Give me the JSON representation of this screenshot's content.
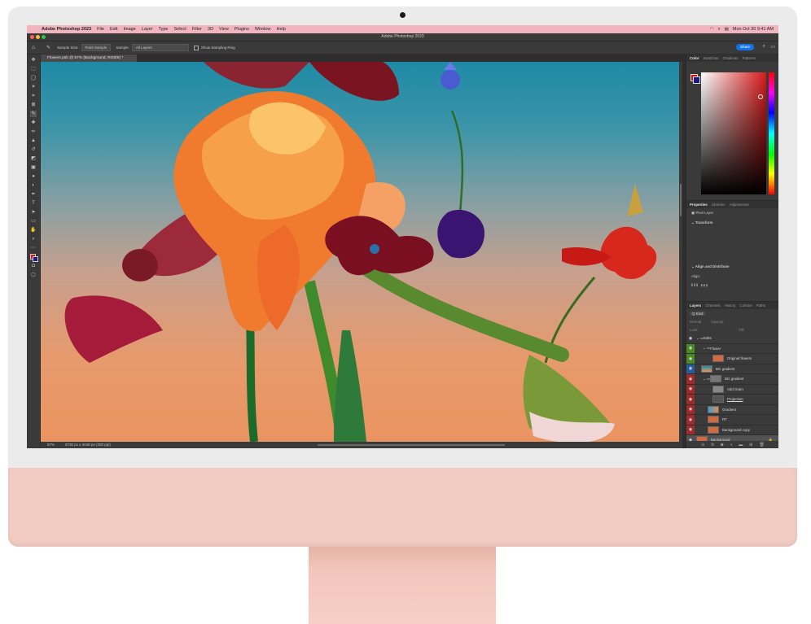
{
  "menubar": {
    "items": [
      "Adobe Photoshop 2023",
      "File",
      "Edit",
      "Image",
      "Layer",
      "Type",
      "Select",
      "Filter",
      "3D",
      "View",
      "Plugins",
      "Window",
      "Help"
    ],
    "clock": "Mon Oct 30  9:41 AM"
  },
  "window": {
    "title": "Adobe Photoshop 2023"
  },
  "options": {
    "sample_size_label": "Sample Size:",
    "sample_size_value": "Point Sample",
    "sample_label": "Sample:",
    "sample_value": "All Layers",
    "ring_label": "Show Sampling Ring",
    "share_label": "Share"
  },
  "document": {
    "tab": "Flowers.psb @ 57% (Background, RGB/8) *"
  },
  "status": {
    "zoom": "57%",
    "dims": "8730 px x 4048 px (300 ppi)"
  },
  "panels": {
    "color_tabs": [
      "Color",
      "Swatches",
      "Gradients",
      "Patterns"
    ],
    "props_tabs": [
      "Properties",
      "Libraries",
      "Adjustments"
    ],
    "pixel_layer": "Pixel Layer",
    "transform": "Transform",
    "align": "Align and Distribute",
    "align_sub": "Align:",
    "layers_tabs": [
      "Layers",
      "Channels",
      "History",
      "Comme",
      "Paths"
    ],
    "kind": "Q Kind",
    "blend": "Normal",
    "opacity": "Opacity:",
    "lock": "Lock:",
    "fill": "Fill:"
  },
  "layers": [
    {
      "name": "Edits"
    },
    {
      "name": "Flower"
    },
    {
      "name": "Original flowers"
    },
    {
      "name": "BG gradient"
    },
    {
      "name": "BG gradient"
    },
    {
      "name": "Add Grain"
    },
    {
      "name": "Projection"
    },
    {
      "name": "Gradient"
    },
    {
      "name": "RT"
    },
    {
      "name": "Background copy"
    },
    {
      "name": "Background"
    }
  ],
  "colors": {
    "menubar": "#f2b5c0",
    "chin": "#f2cbc2",
    "accent": "#1473e6"
  }
}
